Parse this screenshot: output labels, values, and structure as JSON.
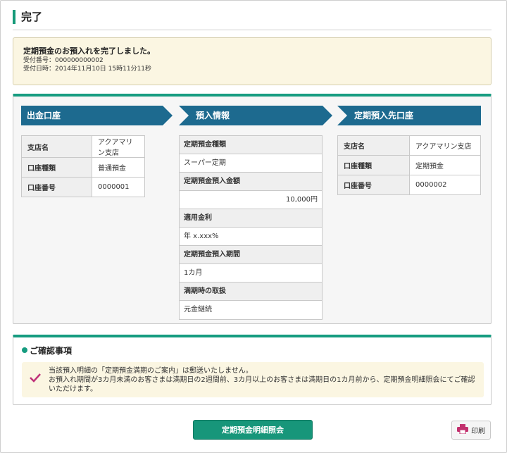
{
  "page": {
    "title": "完了"
  },
  "notice": {
    "message": "定期預金のお預入れを完了しました。",
    "receipt_number": "受付番号：000000000002",
    "receipt_datetime": "受付日時：2014年11月10日 15時11分11秒"
  },
  "sections": {
    "source": {
      "title": "出金口座",
      "rows": [
        {
          "label": "支店名",
          "value": "アクアマリン支店"
        },
        {
          "label": "口座種類",
          "value": "普通預金"
        },
        {
          "label": "口座番号",
          "value": "0000001"
        }
      ]
    },
    "deposit": {
      "title": "預入情報",
      "items": [
        {
          "label": "定期預金種類",
          "value": "スーパー定期"
        },
        {
          "label": "定期預金預入金額",
          "value": "10,000円"
        },
        {
          "label": "適用金利",
          "value": "年 x.xxx%"
        },
        {
          "label": "定期預金預入期間",
          "value": "1カ月"
        },
        {
          "label": "満期時の取扱",
          "value": "元金継続"
        }
      ]
    },
    "destination": {
      "title": "定期預入先口座",
      "rows": [
        {
          "label": "支店名",
          "value": "アクアマリン支店"
        },
        {
          "label": "口座種類",
          "value": "定期預金"
        },
        {
          "label": "口座番号",
          "value": "0000002"
        }
      ]
    }
  },
  "confirm": {
    "title": "ご確認事項",
    "line1": "当該預入明細の「定期預金満期のご案内」は郵送いたしません。",
    "line2": "お預入れ期間が3カ月未満のお客さまは満期日の2週間前、3カ月以上のお客さまは満期日の1カ月前から、定期預金明細照会にてご確認いただけます。"
  },
  "buttons": {
    "primary": "定期預金明細照会",
    "print": "印刷"
  },
  "colors": {
    "accent": "#169c80",
    "header_bar": "#1d6a8f",
    "notice_bg": "#fbf6e2",
    "check": "#c0327a",
    "print_icon": "#c2306d"
  },
  "icons": {
    "check": "checkmark-icon",
    "print": "printer-icon"
  }
}
